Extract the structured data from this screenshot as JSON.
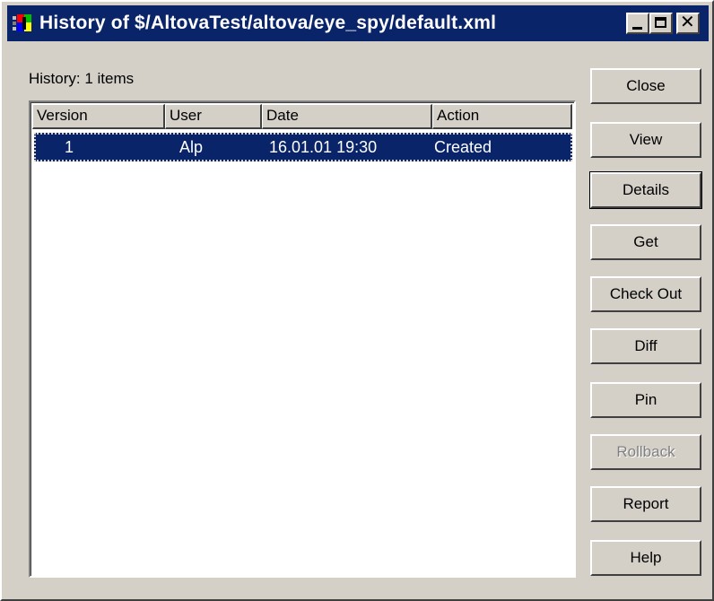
{
  "window": {
    "title": "History of $/AltovaTest/altova/eye_spy/default.xml",
    "icon": "vss-app-icon",
    "controls": {
      "minimize": "minimize-icon",
      "maximize": "maximize-icon",
      "close_glyph": "✕"
    }
  },
  "history": {
    "label": "History: 1 items"
  },
  "list": {
    "columns": [
      "Version",
      "User",
      "Date",
      "Action"
    ],
    "rows": [
      {
        "version": "1",
        "user": "Alp",
        "date": "16.01.01 19:30",
        "action": "Created",
        "selected": true
      }
    ]
  },
  "buttons": {
    "close": "Close",
    "view": "View",
    "details": "Details",
    "get": "Get",
    "check_out": "Check Out",
    "diff": "Diff",
    "pin": "Pin",
    "rollback": "Rollback",
    "report": "Report",
    "help": "Help"
  },
  "colors": {
    "titlebar": "#0a246a",
    "face": "#d4d0c8",
    "selection": "#0a246a",
    "disabled_text": "#808080"
  }
}
